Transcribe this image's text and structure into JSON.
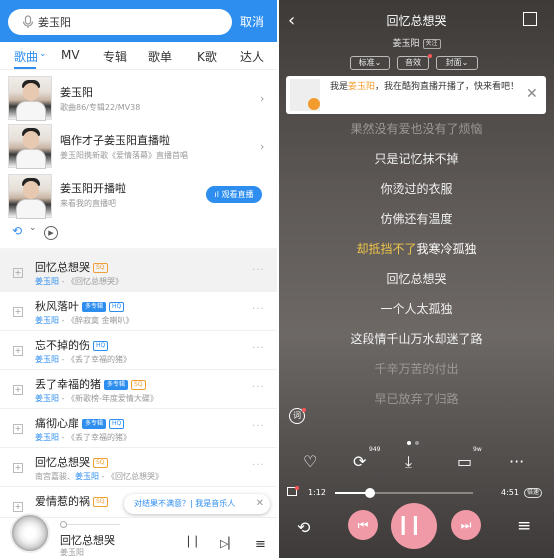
{
  "left": {
    "search": {
      "value": "姜玉阳",
      "cancel_label": "取消"
    },
    "tabs": [
      "歌曲",
      "MV",
      "专辑",
      "歌单",
      "K歌",
      "达人"
    ],
    "active_tab": "歌曲",
    "artists": [
      {
        "title": "姜玉阳",
        "sub": "歌曲86/专辑22/MV38"
      },
      {
        "title": "唱作才子姜玉阳直播啦",
        "sub": "姜玉阳携新歌《爱情落幕》直播首唱"
      },
      {
        "title": "姜玉阳开播啦",
        "sub": "来看我的直播吧",
        "button": "观看直播"
      }
    ],
    "songs": [
      {
        "title": "回忆总想哭",
        "tags": [
          "SQ"
        ],
        "artist": "姜玉阳",
        "album": " - 《回忆总想哭》"
      },
      {
        "title": "秋风落叶",
        "tags": [
          "多专辑",
          "HQ"
        ],
        "artist": "姜玉阳",
        "album": " - 《醉寂寞 金喇叭》"
      },
      {
        "title": "忘不掉的伤",
        "tags": [
          "HQ"
        ],
        "artist": "姜玉阳",
        "album": " - 《丢了幸福的猪》"
      },
      {
        "title": "丢了幸福的猪",
        "tags": [
          "多专辑",
          "SQ"
        ],
        "artist": "姜玉阳",
        "album": " - 《新歌榜-年度爱情大碟》"
      },
      {
        "title": "痛彻心扉",
        "tags": [
          "多专辑",
          "HQ"
        ],
        "artist": "姜玉阳",
        "album": " - 《丢了幸福的猪》"
      },
      {
        "title": "回忆总想哭",
        "tags": [
          "SQ"
        ],
        "prefix": "南宫嘉骏、",
        "artist": "姜玉阳",
        "album": " - 《回忆总想哭》"
      },
      {
        "title": "爱情惹的祸",
        "tags": [
          "SQ"
        ],
        "artist": "",
        "album": ""
      }
    ],
    "feedback": {
      "text": "对结果不满意？| 我是音乐人",
      "close": "✕"
    },
    "mini_player": {
      "title": "回忆总想哭",
      "artist": "姜玉阳",
      "pause": "▏▏",
      "next": "▷▏",
      "list": "≡"
    },
    "tools": {
      "chevron": "⌄"
    }
  },
  "right": {
    "back": "‹",
    "title": "回忆总想哭",
    "artist": "姜玉阳",
    "artist_tag": "关注",
    "pills": [
      "标准⌄",
      "音效",
      "封面⌄"
    ],
    "notice": {
      "pre": "我是",
      "artist": "姜玉阳",
      "post": "，我在酷狗直播开播了，快来看吧！",
      "close": "✕"
    },
    "lyrics": [
      {
        "text": "果然没有爱也没有了烦恼",
        "state": "fade"
      },
      {
        "text": "只是记忆抹不掉",
        "state": "normal"
      },
      {
        "text": "你烫过的衣服",
        "state": "normal"
      },
      {
        "text": "仿佛还有温度",
        "state": "normal"
      },
      {
        "sung": "却抵挡不了",
        "rest": "我寒冷孤独",
        "state": "cur"
      },
      {
        "text": "回忆总想哭",
        "state": "normal"
      },
      {
        "text": "一个人太孤独",
        "state": "normal"
      },
      {
        "text": "这段情千山万水却迷了路",
        "state": "normal"
      },
      {
        "text": "千辛万苦的付出",
        "state": "fade"
      },
      {
        "text": "早已放弃了归路",
        "state": "fade"
      }
    ],
    "comment_badge": "词",
    "actions": {
      "like": "♡",
      "share_count": "949",
      "download": "⤓",
      "comment_count": "9w",
      "more": "···"
    },
    "progress": {
      "current": "1:12",
      "total": "4:51",
      "speed": "倍速",
      "fraction": 0.25
    },
    "controls": {
      "mode": "⟲",
      "prev": "⏮",
      "pause": "▎▎",
      "next": "⏭",
      "list": "≡"
    }
  }
}
